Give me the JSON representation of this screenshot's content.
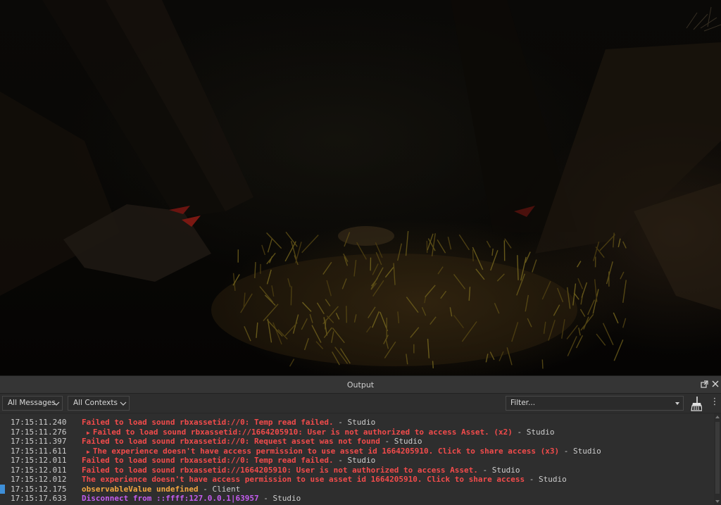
{
  "panel": {
    "title": "Output",
    "message_filter": "All Messages",
    "context_filter": "All Contexts",
    "filter_placeholder": "Filter..."
  },
  "icons": {
    "undock": "undock-icon",
    "close": "close-icon",
    "clear": "broom-icon",
    "more": "more-vertical-icon",
    "chevron": "chevron-down-icon"
  },
  "colors": {
    "error": "#f24b4b",
    "warning": "#f2a640",
    "info": "#c45cf0",
    "text": "#cdcdcd",
    "selection": "#3e8fd8"
  },
  "log": [
    {
      "time": "17:15:11.240",
      "message": "Failed to load sound rbxassetid://0: Temp read failed.",
      "source": "Studio",
      "level": "error",
      "expandable": false
    },
    {
      "time": "17:15:11.276",
      "message": "Failed to load sound rbxassetid://1664205910: User is not authorized to access Asset. (x2)",
      "source": "Studio",
      "level": "error",
      "expandable": true
    },
    {
      "time": "17:15:11.397",
      "message": "Failed to load sound rbxassetid://0: Request asset was not found",
      "source": "Studio",
      "level": "error",
      "expandable": false
    },
    {
      "time": "17:15:11.611",
      "message": "The experience doesn't have access permission to use asset id 1664205910. Click to share access (x3)",
      "source": "Studio",
      "level": "error",
      "expandable": true
    },
    {
      "time": "17:15:12.011",
      "message": "Failed to load sound rbxassetid://0: Temp read failed.",
      "source": "Studio",
      "level": "error",
      "expandable": false
    },
    {
      "time": "17:15:12.011",
      "message": "Failed to load sound rbxassetid://1664205910: User is not authorized to access Asset.",
      "source": "Studio",
      "level": "error",
      "expandable": false
    },
    {
      "time": "17:15:12.012",
      "message": "The experience doesn't have access permission to use asset id 1664205910. Click to share access",
      "source": "Studio",
      "level": "error",
      "expandable": false
    },
    {
      "time": "17:15:12.175",
      "message": "observableValue undefined",
      "source": "Client",
      "level": "warning",
      "expandable": false,
      "selected": true
    },
    {
      "time": "17:15:17.633",
      "message": "Disconnect from ::ffff:127.0.0.1|63957",
      "source": "Studio",
      "level": "info",
      "expandable": false
    }
  ]
}
